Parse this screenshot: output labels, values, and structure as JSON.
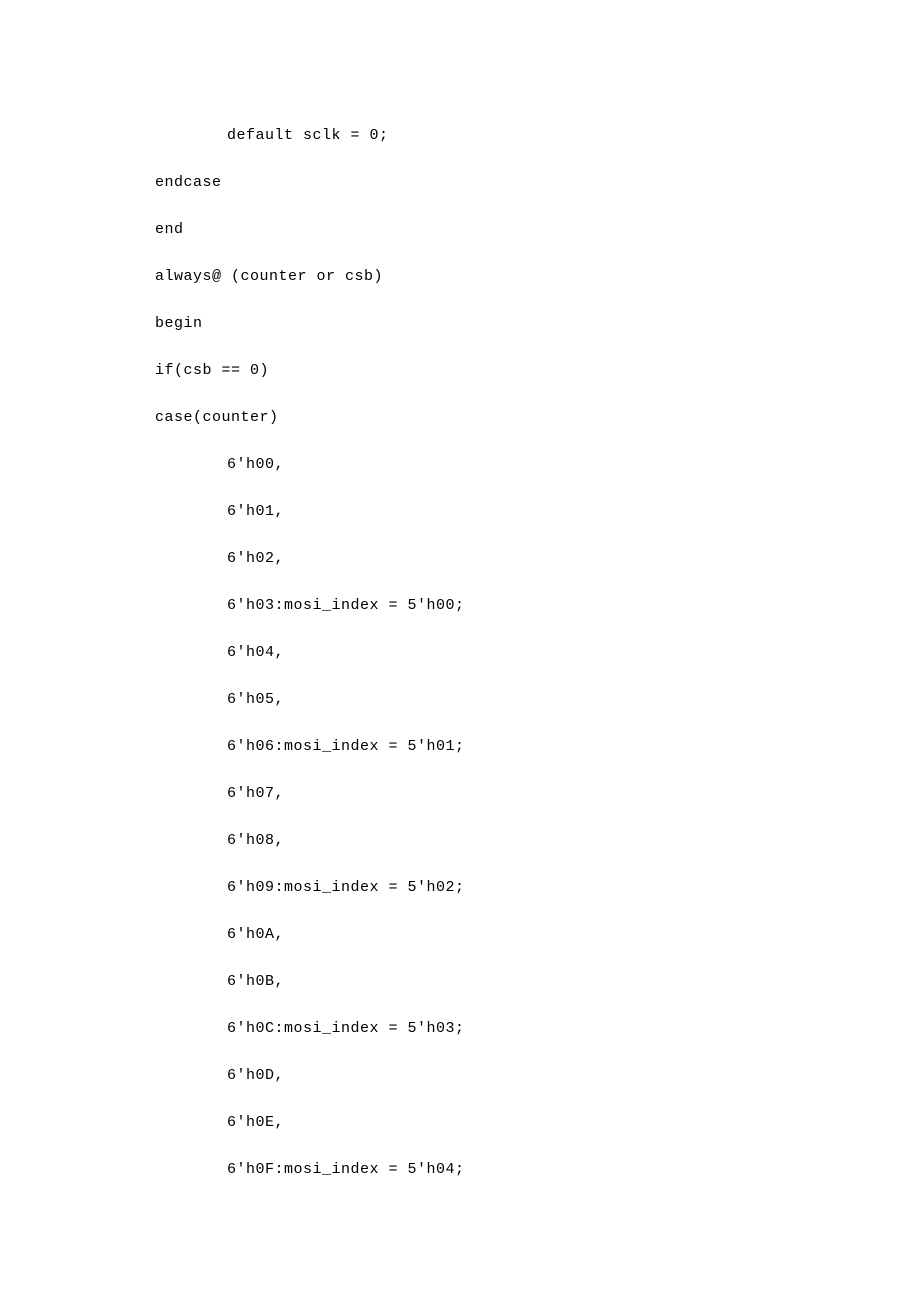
{
  "code": {
    "l00": "default sclk = 0;",
    "l01": "endcase",
    "l02": "end",
    "l03": "always@ (counter or csb)",
    "l04": "begin",
    "l05": "if(csb == 0)",
    "l06": "case(counter)",
    "l07": "6'h00,",
    "l08": "6'h01,",
    "l09": "6'h02,",
    "l10": "6'h03:mosi_index = 5'h00;",
    "l11": "6'h04,",
    "l12": "6'h05,",
    "l13": "6'h06:mosi_index = 5'h01;",
    "l14": "6'h07,",
    "l15": "6'h08,",
    "l16": "6'h09:mosi_index = 5'h02;",
    "l17": "6'h0A,",
    "l18": "6'h0B,",
    "l19": "6'h0C:mosi_index = 5'h03;",
    "l20": "6'h0D,",
    "l21": "6'h0E,",
    "l22": "6'h0F:mosi_index = 5'h04;"
  }
}
